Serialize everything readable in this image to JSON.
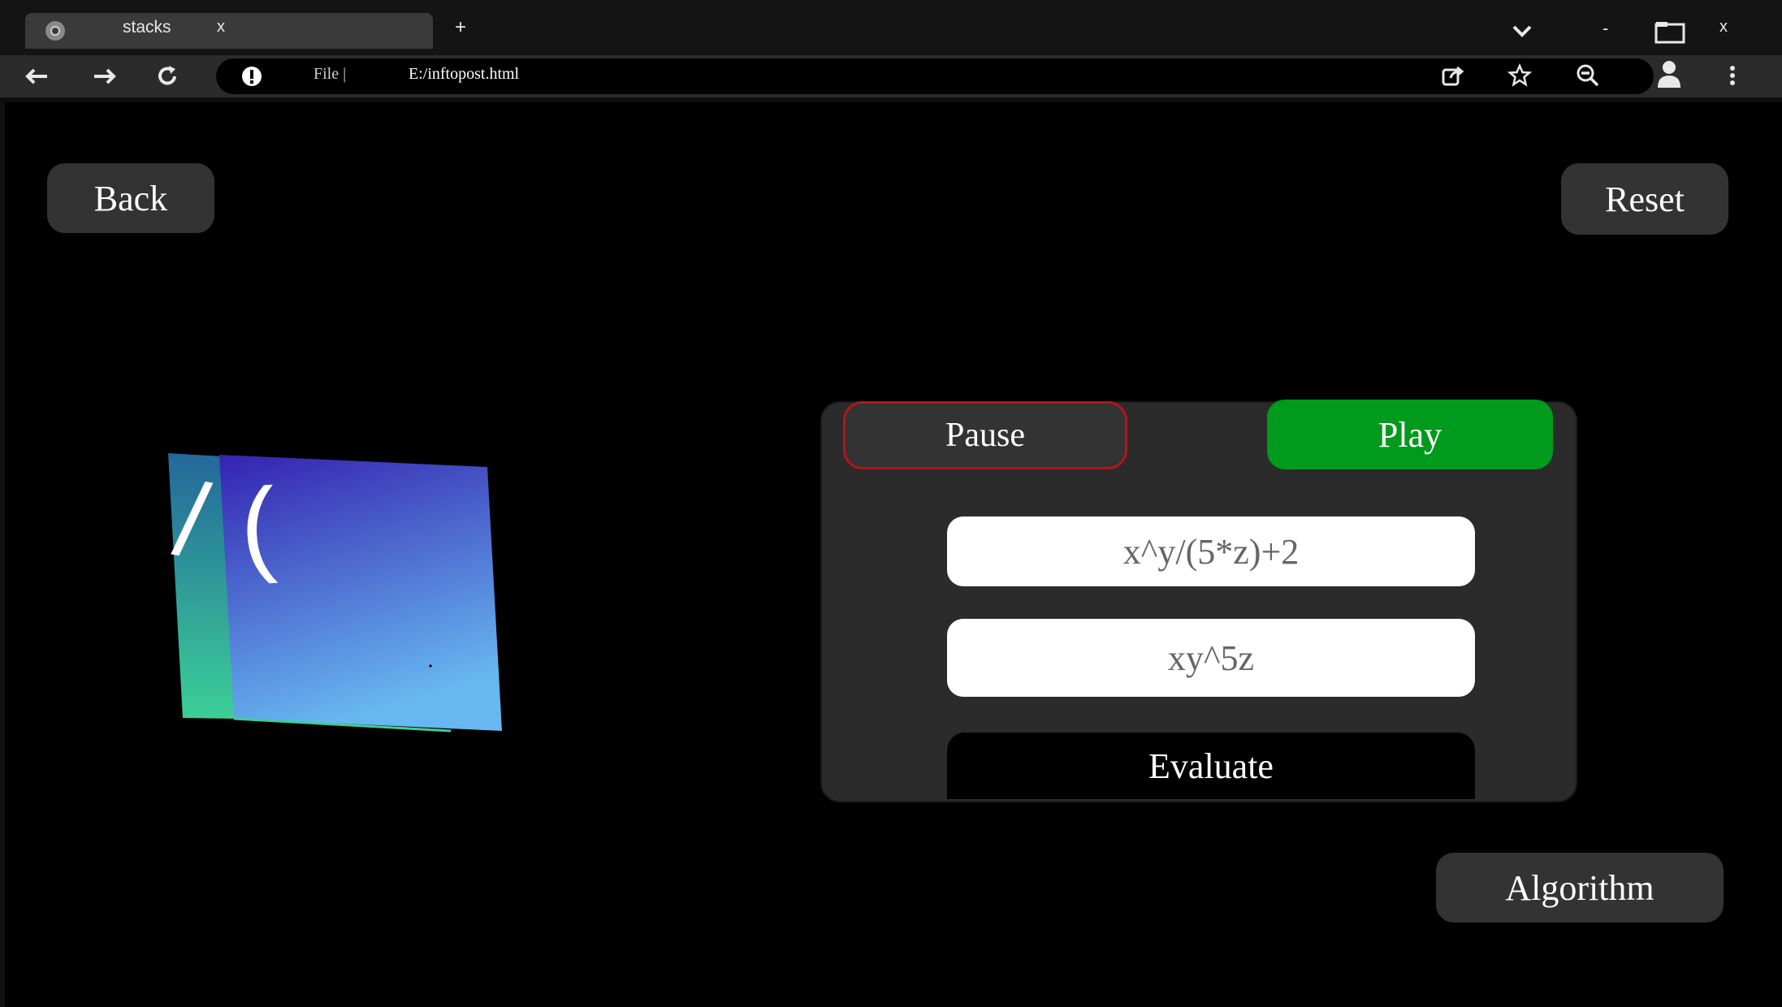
{
  "browser": {
    "tab": {
      "title": "stacks",
      "close": "x"
    },
    "new_tab": "+",
    "window": {
      "minimize": "-",
      "close": "x"
    },
    "address": {
      "scheme_label": "File |",
      "url": "E:/inftopost.html"
    }
  },
  "page": {
    "back_label": "Back",
    "reset_label": "Reset",
    "algorithm_label": "Algorithm",
    "controls": {
      "pause_label": "Pause",
      "play_label": "Play",
      "infix_expression": "x^y/(5*z)+2",
      "postfix_expression": "xy^5z",
      "evaluate_label": "Evaluate"
    },
    "stack": {
      "items": [
        "/",
        "("
      ]
    }
  },
  "colors": {
    "play": "#009a1c",
    "pause_border": "#b0161e",
    "panel": "#2b2b2b",
    "button": "#333333"
  }
}
